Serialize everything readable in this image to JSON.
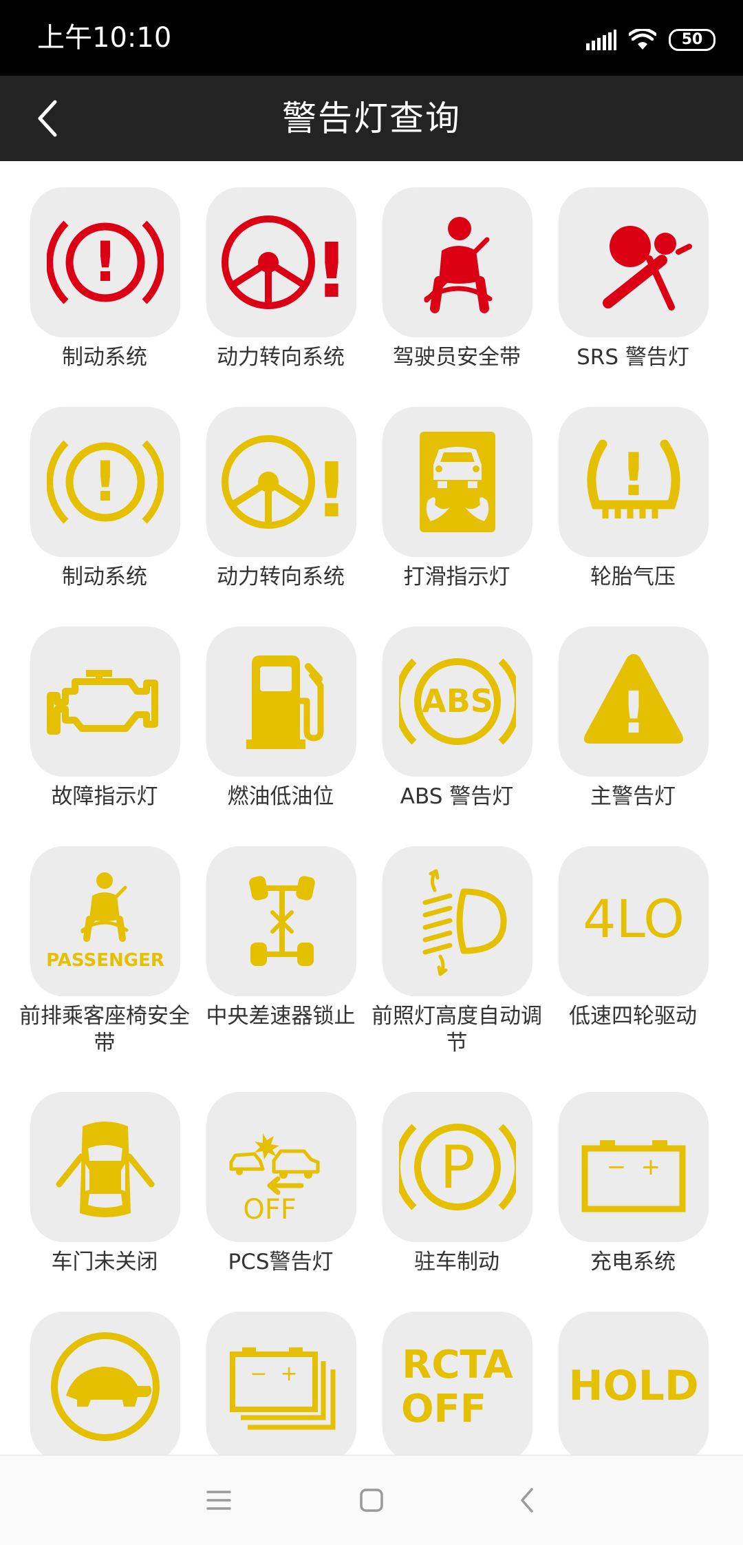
{
  "status_bar": {
    "time": "上午10:10",
    "battery_level": "50",
    "icons": [
      "signal-icon",
      "wifi-icon",
      "battery-icon"
    ]
  },
  "app_bar": {
    "back_icon": "chevron-left-icon",
    "title": "警告灯查询"
  },
  "colors": {
    "red": "#dc0014",
    "yellow": "#e4c000",
    "tile": "#ececec",
    "label": "#333333",
    "status_bar": "#000000",
    "app_bar": "#232323"
  },
  "lights": [
    {
      "label": "制动系统",
      "icon_text": "!",
      "icon": "brake-warning-icon",
      "color": "red"
    },
    {
      "label": "动力转向系统",
      "icon_text": "!",
      "icon": "power-steering-icon",
      "color": "red"
    },
    {
      "label": "驾驶员安全带",
      "icon": "seatbelt-icon",
      "color": "red"
    },
    {
      "label": "SRS 警告灯",
      "icon": "airbag-icon",
      "color": "red"
    },
    {
      "label": "制动系统",
      "icon_text": "!",
      "icon": "brake-warning-icon",
      "color": "yellow"
    },
    {
      "label": "动力转向系统",
      "icon_text": "!",
      "icon": "power-steering-icon",
      "color": "yellow"
    },
    {
      "label": "打滑指示灯",
      "icon": "skid-car-icon",
      "color": "yellow"
    },
    {
      "label": "轮胎气压",
      "icon_text": "!",
      "icon": "tire-pressure-icon",
      "color": "yellow"
    },
    {
      "label": "故障指示灯",
      "icon": "engine-icon",
      "color": "yellow"
    },
    {
      "label": "燃油低油位",
      "icon": "fuel-pump-icon",
      "color": "yellow"
    },
    {
      "label": "ABS 警告灯",
      "icon_text": "ABS",
      "icon": "abs-icon",
      "color": "yellow"
    },
    {
      "label": "主警告灯",
      "icon_text": "!",
      "icon": "master-warning-icon",
      "color": "yellow"
    },
    {
      "label": "前排乘客座椅安全带",
      "icon_text": "PASSENGER",
      "icon": "passenger-seatbelt-icon",
      "color": "yellow"
    },
    {
      "label": "中央差速器锁止",
      "icon": "center-diff-lock-icon",
      "color": "yellow"
    },
    {
      "label": "前照灯高度自动调节",
      "icon": "headlight-leveling-icon",
      "color": "yellow"
    },
    {
      "label": "低速四轮驱动",
      "icon_text": "4LO",
      "icon": "4lo-icon",
      "color": "yellow"
    },
    {
      "label": "车门未关闭",
      "icon": "door-open-icon",
      "color": "yellow"
    },
    {
      "label": "PCS警告灯",
      "icon_text": "OFF",
      "icon": "pcs-icon",
      "color": "yellow"
    },
    {
      "label": "驻车制动",
      "icon_text": "P",
      "icon": "parking-brake-icon",
      "color": "yellow"
    },
    {
      "label": "充电系统",
      "icon_text": "−  +",
      "icon": "battery-charge-icon",
      "color": "yellow"
    },
    {
      "label": "",
      "icon": "turtle-icon",
      "color": "yellow"
    },
    {
      "label": "",
      "icon_text": "−  +",
      "icon": "battery-stack-icon",
      "color": "yellow"
    },
    {
      "label": "",
      "icon_text": "RCTA",
      "icon_text_2": "OFF",
      "icon": "rcta-off-icon",
      "color": "yellow"
    },
    {
      "label": "",
      "icon_text": "HOLD",
      "icon": "hold-icon",
      "color": "yellow"
    }
  ],
  "nav_bar": {
    "icons": [
      "menu-icon",
      "home-icon",
      "back-triangle-icon"
    ]
  }
}
